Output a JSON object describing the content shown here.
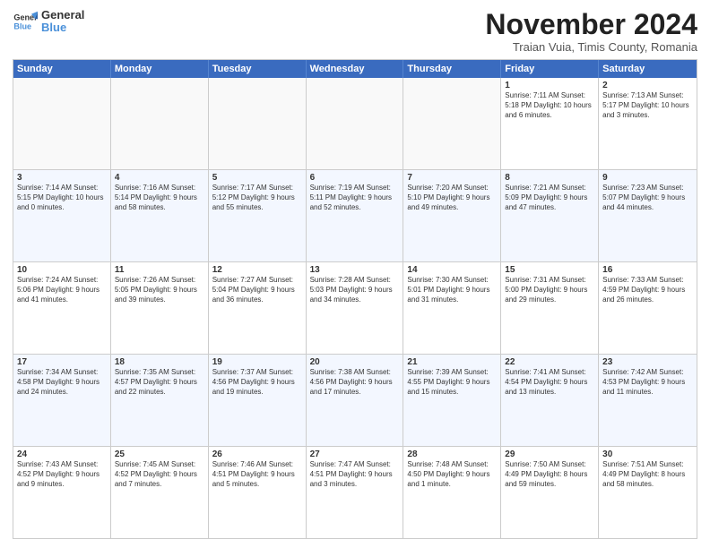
{
  "header": {
    "logo_line1": "General",
    "logo_line2": "Blue",
    "month": "November 2024",
    "location": "Traian Vuia, Timis County, Romania"
  },
  "weekdays": [
    "Sunday",
    "Monday",
    "Tuesday",
    "Wednesday",
    "Thursday",
    "Friday",
    "Saturday"
  ],
  "rows": [
    [
      {
        "day": "",
        "info": "",
        "empty": true
      },
      {
        "day": "",
        "info": "",
        "empty": true
      },
      {
        "day": "",
        "info": "",
        "empty": true
      },
      {
        "day": "",
        "info": "",
        "empty": true
      },
      {
        "day": "",
        "info": "",
        "empty": true
      },
      {
        "day": "1",
        "info": "Sunrise: 7:11 AM\nSunset: 5:18 PM\nDaylight: 10 hours\nand 6 minutes.",
        "empty": false
      },
      {
        "day": "2",
        "info": "Sunrise: 7:13 AM\nSunset: 5:17 PM\nDaylight: 10 hours\nand 3 minutes.",
        "empty": false
      }
    ],
    [
      {
        "day": "3",
        "info": "Sunrise: 7:14 AM\nSunset: 5:15 PM\nDaylight: 10 hours\nand 0 minutes.",
        "empty": false
      },
      {
        "day": "4",
        "info": "Sunrise: 7:16 AM\nSunset: 5:14 PM\nDaylight: 9 hours\nand 58 minutes.",
        "empty": false
      },
      {
        "day": "5",
        "info": "Sunrise: 7:17 AM\nSunset: 5:12 PM\nDaylight: 9 hours\nand 55 minutes.",
        "empty": false
      },
      {
        "day": "6",
        "info": "Sunrise: 7:19 AM\nSunset: 5:11 PM\nDaylight: 9 hours\nand 52 minutes.",
        "empty": false
      },
      {
        "day": "7",
        "info": "Sunrise: 7:20 AM\nSunset: 5:10 PM\nDaylight: 9 hours\nand 49 minutes.",
        "empty": false
      },
      {
        "day": "8",
        "info": "Sunrise: 7:21 AM\nSunset: 5:09 PM\nDaylight: 9 hours\nand 47 minutes.",
        "empty": false
      },
      {
        "day": "9",
        "info": "Sunrise: 7:23 AM\nSunset: 5:07 PM\nDaylight: 9 hours\nand 44 minutes.",
        "empty": false
      }
    ],
    [
      {
        "day": "10",
        "info": "Sunrise: 7:24 AM\nSunset: 5:06 PM\nDaylight: 9 hours\nand 41 minutes.",
        "empty": false
      },
      {
        "day": "11",
        "info": "Sunrise: 7:26 AM\nSunset: 5:05 PM\nDaylight: 9 hours\nand 39 minutes.",
        "empty": false
      },
      {
        "day": "12",
        "info": "Sunrise: 7:27 AM\nSunset: 5:04 PM\nDaylight: 9 hours\nand 36 minutes.",
        "empty": false
      },
      {
        "day": "13",
        "info": "Sunrise: 7:28 AM\nSunset: 5:03 PM\nDaylight: 9 hours\nand 34 minutes.",
        "empty": false
      },
      {
        "day": "14",
        "info": "Sunrise: 7:30 AM\nSunset: 5:01 PM\nDaylight: 9 hours\nand 31 minutes.",
        "empty": false
      },
      {
        "day": "15",
        "info": "Sunrise: 7:31 AM\nSunset: 5:00 PM\nDaylight: 9 hours\nand 29 minutes.",
        "empty": false
      },
      {
        "day": "16",
        "info": "Sunrise: 7:33 AM\nSunset: 4:59 PM\nDaylight: 9 hours\nand 26 minutes.",
        "empty": false
      }
    ],
    [
      {
        "day": "17",
        "info": "Sunrise: 7:34 AM\nSunset: 4:58 PM\nDaylight: 9 hours\nand 24 minutes.",
        "empty": false
      },
      {
        "day": "18",
        "info": "Sunrise: 7:35 AM\nSunset: 4:57 PM\nDaylight: 9 hours\nand 22 minutes.",
        "empty": false
      },
      {
        "day": "19",
        "info": "Sunrise: 7:37 AM\nSunset: 4:56 PM\nDaylight: 9 hours\nand 19 minutes.",
        "empty": false
      },
      {
        "day": "20",
        "info": "Sunrise: 7:38 AM\nSunset: 4:56 PM\nDaylight: 9 hours\nand 17 minutes.",
        "empty": false
      },
      {
        "day": "21",
        "info": "Sunrise: 7:39 AM\nSunset: 4:55 PM\nDaylight: 9 hours\nand 15 minutes.",
        "empty": false
      },
      {
        "day": "22",
        "info": "Sunrise: 7:41 AM\nSunset: 4:54 PM\nDaylight: 9 hours\nand 13 minutes.",
        "empty": false
      },
      {
        "day": "23",
        "info": "Sunrise: 7:42 AM\nSunset: 4:53 PM\nDaylight: 9 hours\nand 11 minutes.",
        "empty": false
      }
    ],
    [
      {
        "day": "24",
        "info": "Sunrise: 7:43 AM\nSunset: 4:52 PM\nDaylight: 9 hours\nand 9 minutes.",
        "empty": false
      },
      {
        "day": "25",
        "info": "Sunrise: 7:45 AM\nSunset: 4:52 PM\nDaylight: 9 hours\nand 7 minutes.",
        "empty": false
      },
      {
        "day": "26",
        "info": "Sunrise: 7:46 AM\nSunset: 4:51 PM\nDaylight: 9 hours\nand 5 minutes.",
        "empty": false
      },
      {
        "day": "27",
        "info": "Sunrise: 7:47 AM\nSunset: 4:51 PM\nDaylight: 9 hours\nand 3 minutes.",
        "empty": false
      },
      {
        "day": "28",
        "info": "Sunrise: 7:48 AM\nSunset: 4:50 PM\nDaylight: 9 hours\nand 1 minute.",
        "empty": false
      },
      {
        "day": "29",
        "info": "Sunrise: 7:50 AM\nSunset: 4:49 PM\nDaylight: 8 hours\nand 59 minutes.",
        "empty": false
      },
      {
        "day": "30",
        "info": "Sunrise: 7:51 AM\nSunset: 4:49 PM\nDaylight: 8 hours\nand 58 minutes.",
        "empty": false
      }
    ]
  ]
}
